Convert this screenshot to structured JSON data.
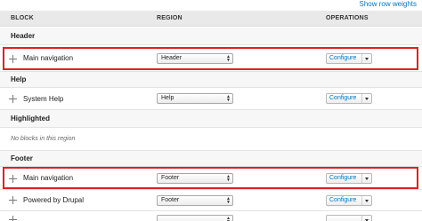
{
  "top_link": "Show row weights",
  "columns": {
    "block": "BLOCK",
    "region": "REGION",
    "operations": "OPERATIONS"
  },
  "regions": [
    {
      "title": "Header"
    },
    {
      "title": "Help"
    },
    {
      "title": "Highlighted",
      "empty_message": "No blocks in this region"
    },
    {
      "title": "Footer"
    }
  ],
  "blocks": [
    {
      "name": "Main navigation",
      "region": "Header",
      "operation": "Configure",
      "highlighted": true
    },
    {
      "name": "System Help",
      "region": "Help",
      "operation": "Configure",
      "highlighted": false
    },
    {
      "name": "Main navigation",
      "region": "Footer",
      "operation": "Configure",
      "highlighted": true
    },
    {
      "name": "Powered by Drupal",
      "region": "Footer",
      "operation": "Configure",
      "highlighted": false
    },
    {
      "name": "",
      "region": "",
      "operation": "",
      "highlighted": false
    }
  ],
  "colors": {
    "highlight": "#e02020",
    "link": "#0074bd"
  }
}
